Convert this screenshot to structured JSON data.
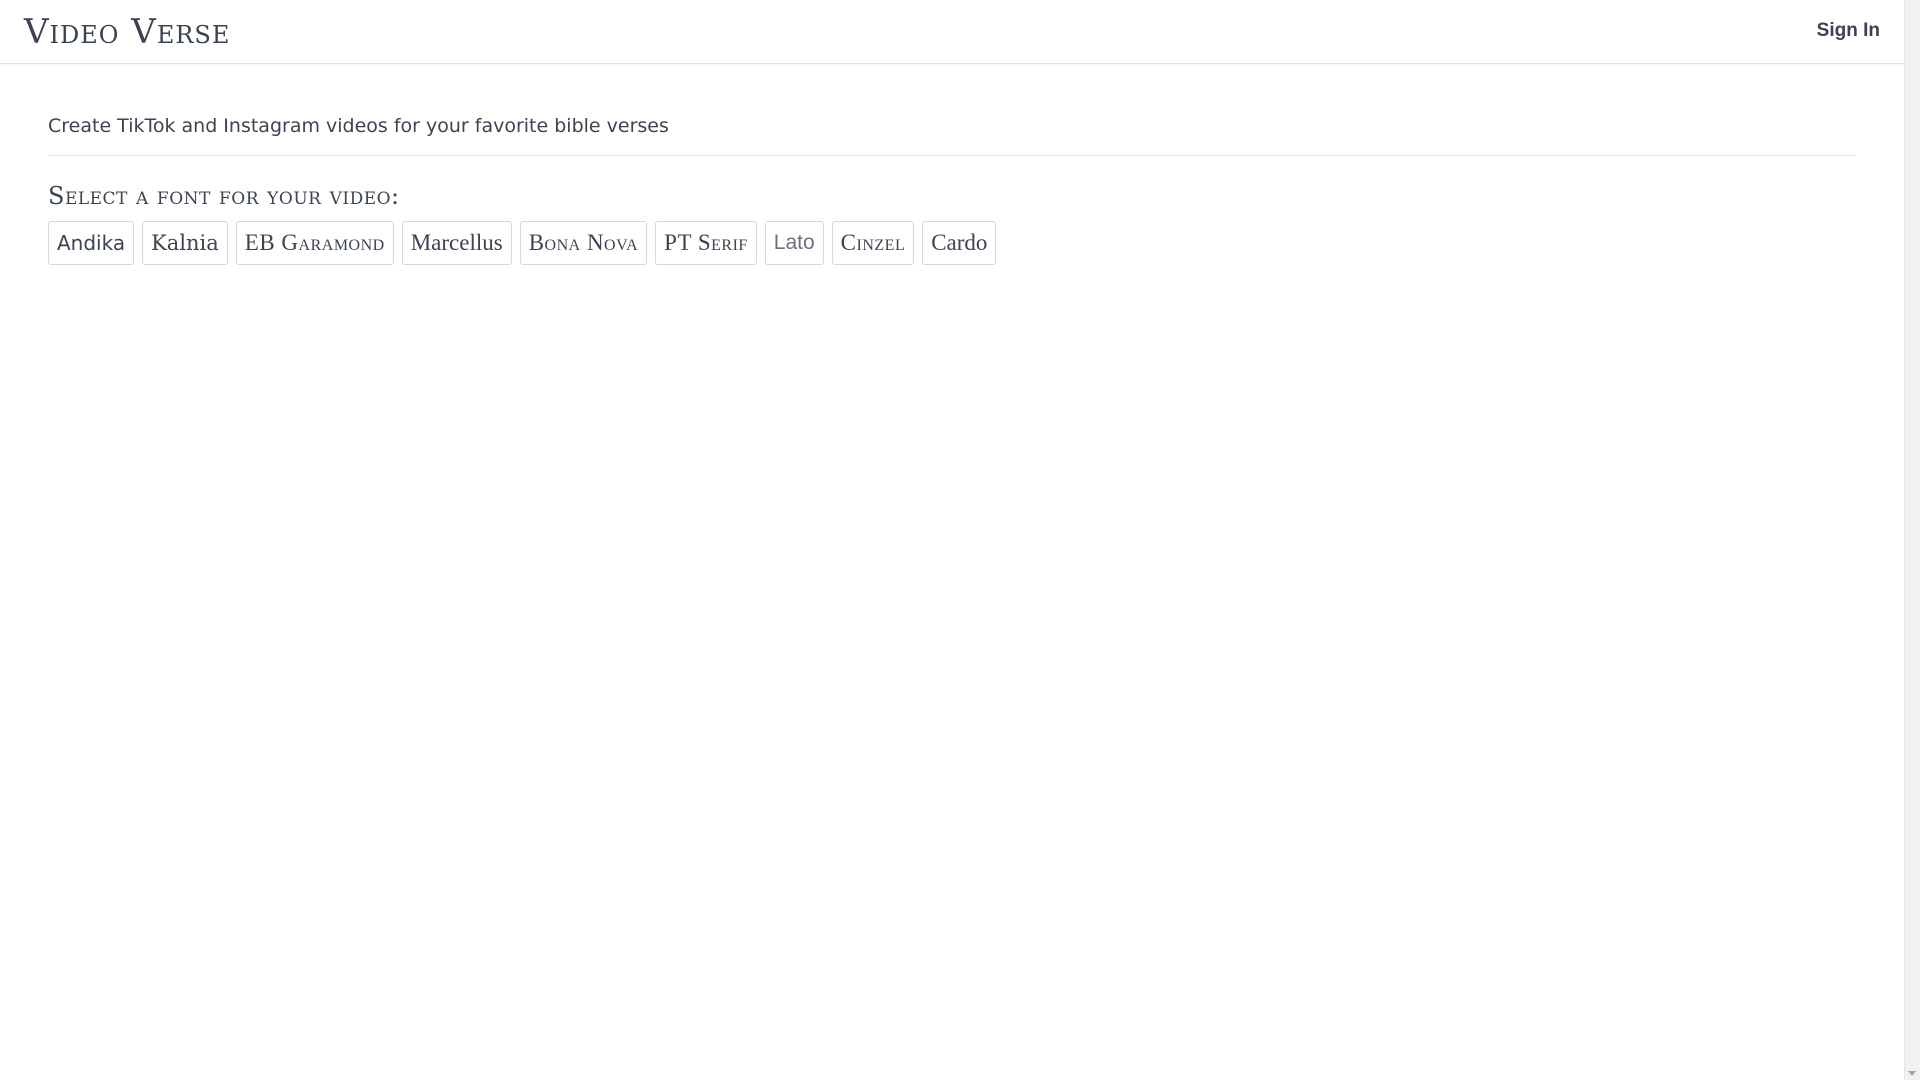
{
  "header": {
    "brand": "Video Verse",
    "sign_in": "Sign In"
  },
  "main": {
    "tagline": "Create TikTok and Instagram videos for your favorite bible verses",
    "font_heading": "Select a font for your video:",
    "fonts": [
      {
        "label": "Andika"
      },
      {
        "label": "Kalnia"
      },
      {
        "label": "EB Garamond"
      },
      {
        "label": "Marcellus"
      },
      {
        "label": "Bona Nova"
      },
      {
        "label": "PT Serif"
      },
      {
        "label": "Lato"
      },
      {
        "label": "Cinzel"
      },
      {
        "label": "Cardo"
      }
    ]
  },
  "icons": {
    "scroll_down": "chevron-down-icon"
  }
}
